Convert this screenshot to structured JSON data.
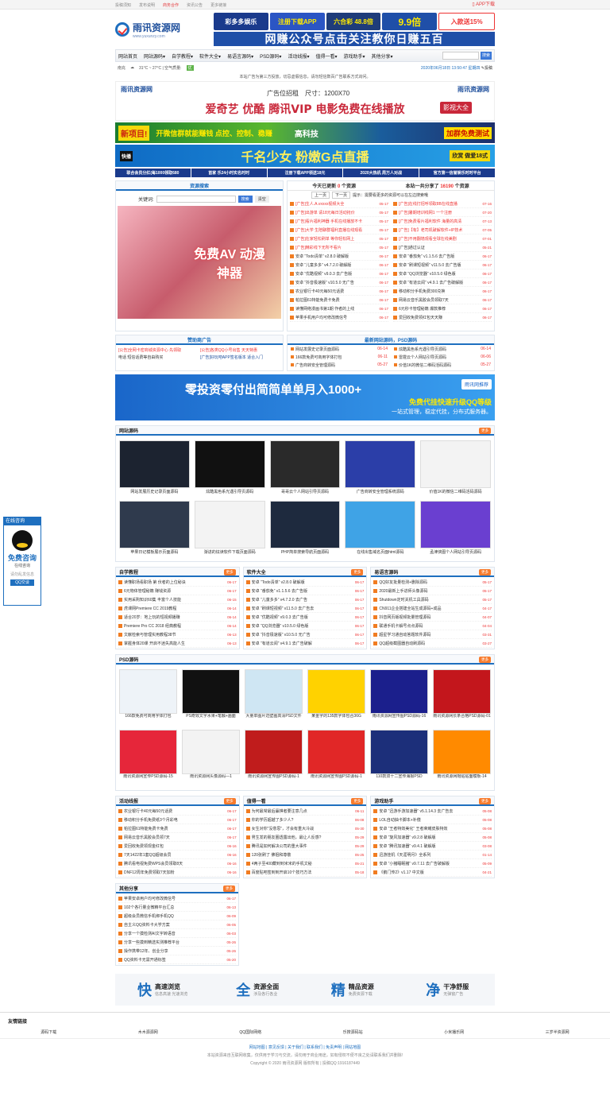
{
  "topbar": {
    "links": [
      "投稿须知",
      "发布说明",
      "商务合作",
      "资讯公告",
      "更多链接"
    ],
    "app": "APP下载"
  },
  "logo": {
    "name": "雨讯资源网",
    "url": "www.yuxunzy.com"
  },
  "header_ads": {
    "a": "彩多多娱乐",
    "b": "注册下载APP",
    "c": "六合彩 48.8倍",
    "d": "9.9倍",
    "e": "入款送15%",
    "big": "网赚公众号点击关注教你日赚五百"
  },
  "nav": {
    "items": [
      "网站首页",
      "网站源码▾",
      "自学教程▾",
      "软件大全▾",
      "易语言源码▾",
      "PSD源码▾",
      "活动线报▾",
      "值得一看▾",
      "游戏助手▾",
      "其他分享▾"
    ],
    "search_btn": "搜索"
  },
  "sub": {
    "city": "南充",
    "weather": "31°C ~ 27°C  | 空气质量:",
    "aqi": "优",
    "datetime": "2020年06月18日 13:50:47 星期四",
    "post": "投稿"
  },
  "notice": "本站广告为第三方投放，切忌虚假信息，请勿轻信数百广告联系方式询问。",
  "banner1": {
    "l1": "广告位招租",
    "size": "尺寸：1200X70",
    "l2": "爱奇艺 优酷 腾讯VIP 电影免费在线播放",
    "tag": "影视大全",
    "logo": "雨讯资源网"
  },
  "banner2": {
    "a": "新项目!",
    "b": "开微信群就能赚钱 点控、控制、稳赚",
    "c": "高科技",
    "d": "加群免费测试"
  },
  "banner3": {
    "kk": "快播",
    "main": "千名少女 粉嫩G点直播",
    "tag": "欣赏 做爱18式"
  },
  "banner4": [
    "联合会员分红(每1000领取680",
    "首家 乐24小时实名时时",
    "注册下载APP领送18元",
    "2020大热机 周万人对战",
    "官方第一信誉娱乐时时平台"
  ],
  "search_panel": {
    "title": "资源搜索",
    "label": "关键词:",
    "btn": "搜索",
    "btn2": "清空",
    "ad": "免费AV 动漫神器"
  },
  "stats": {
    "today_label": "今天已更新",
    "today": "0",
    "today_unit": "个资源",
    "total_label": "本站一共分享了",
    "total": "16190",
    "total_unit": "个资源",
    "prev": "上一页",
    "next": "下一页",
    "tip": "提示：需要看更多的资源可以在左边搜索哦"
  },
  "updates_left": [
    {
      "t": "[广告]生人.A.vxxxx视频大全",
      "d": "05-17",
      "red": true
    },
    {
      "t": "[广告]出游单 请18元每日活动抢价",
      "d": "05-17",
      "red": true
    },
    {
      "t": "[广告]看片福利神器 手机在线播放不卡",
      "d": "05-17",
      "red": true
    },
    {
      "t": "[广告]大学 生陪聊群福利直播在线观看",
      "d": "05-17",
      "red": true
    },
    {
      "t": "[广告]在家轻松刷单 等你轻松网上",
      "d": "05-17",
      "red": true
    },
    {
      "t": "[广告]精彩线下无所不看片",
      "d": "05-17",
      "red": true
    },
    {
      "t": "安卓 “Todo清单” v2.8.0 破解版",
      "d": "06-17",
      "red": false
    },
    {
      "t": "安卓 “儿童多多” v4.7.2.0 破解版",
      "d": "06-17",
      "red": false
    },
    {
      "t": "安卓 “优酷视频” v9.0.3 去广告版",
      "d": "06-17",
      "red": false
    },
    {
      "t": "安卓 “抖音极速版” v10.5.0 无广告",
      "d": "06-17",
      "red": false
    },
    {
      "t": "农业银行卡40元每50元话费",
      "d": "06-17",
      "red": false
    },
    {
      "t": "帕拉图61特能免费卡免费",
      "d": "06-17",
      "red": false
    },
    {
      "t": "读懂网络漫画书第1期 作者的上线",
      "d": "06-17",
      "red": false
    },
    {
      "t": "苹果手机用户均可修改微信号",
      "d": "06-17",
      "red": false
    }
  ],
  "updates_right": [
    {
      "t": "[广告]在线打招呼领取8B在线直播",
      "d": "07-16",
      "red": true
    },
    {
      "t": "[广告]暑期培训线网1 一个注册",
      "d": "07-20",
      "red": true
    },
    {
      "t": "[广告]免费看片福利软件 海量的高清",
      "d": "07-13",
      "red": true
    },
    {
      "t": "[广告]【有】老司机破解软件+IP技术",
      "d": "07-05",
      "red": true
    },
    {
      "t": "[广告]不用翻墙观看全球在线美剧",
      "d": "07-01",
      "red": true
    },
    {
      "t": "[广告]通过认证",
      "d": "05-21",
      "red": false
    },
    {
      "t": "安卓 “番茄免” v1.1.5.6 去广告版",
      "d": "06-17",
      "red": false
    },
    {
      "t": "安卓 “刷课短视频” v11.5.0 去广告版",
      "d": "06-17",
      "red": false
    },
    {
      "t": "安卓 “QQ浏览器” v10.5.0 绿色版",
      "d": "06-17",
      "red": false
    },
    {
      "t": "安卓 “有道云阅” v4.9.1 去广告破解版",
      "d": "06-17",
      "red": false
    },
    {
      "t": "移动积分手机免费300兑换",
      "d": "06-17",
      "red": false
    },
    {
      "t": "网易云音乐黑胶会员领取7天",
      "d": "06-17",
      "red": false
    },
    {
      "t": "6元秒卡管理秘籍 爆款推荐",
      "d": "06-17",
      "red": false
    },
    {
      "t": "爱回收免费领红包天天赚",
      "d": "06-17",
      "red": false
    }
  ],
  "sponsor": {
    "title": "赞助商广告",
    "items": [
      "[公告]全网卡密商城资源中心 先领取",
      "[公告]各类QQ小号出售 天天特惠",
      "电话 短信话费等自由购买",
      "[广告]好玩吧APP签名版本 适合入门"
    ]
  },
  "latest": {
    "title": "最新网站源码，PSD源码",
    "items": [
      {
        "t": "网站发展史记录页面源码",
        "d": "06-14"
      },
      {
        "t": "炫酷黑色系光遇引导页源码",
        "d": "06-14"
      },
      {
        "t": "166款免费可商用字体打包",
        "d": "06-11"
      },
      {
        "t": "雷霆云个人网站引导页源码",
        "d": "06-06"
      },
      {
        "t": "广告商转安全管理源码",
        "d": "05-27"
      },
      {
        "t": "价值1K的微信二维码活码源码",
        "d": "05-27"
      }
    ]
  },
  "wide_banner": {
    "main": "零投资零付出简简单单月入1000+",
    "sub": "一站式管理，稳定代挂，分布式服务器。",
    "right": "免费代挂快速升级QQ等级",
    "brand": "雨讯网推荐"
  },
  "site_code": {
    "title": "网站源码",
    "more": "更多",
    "items": [
      "网站发展历史记录页面源码",
      "炫酷黑色系光遇引导页源码",
      "哥哥云个人网站引导页源码",
      "广告商转安全管理系统源码",
      "价值1K的微信二维码活码源码",
      "苹果日记模板展示页面源码",
      "渐进的炫读软件下载页面源码",
      "PHP简单搜索导航页面源码",
      "在线出售域名页面html源码",
      "孟津侠图个人网站引导页源码"
    ]
  },
  "tutorial": {
    "title": "自学教程",
    "more": "更多",
    "items": [
      {
        "t": "读懂职场看职场 第 伏者的上位秘诀",
        "d": "06-17"
      },
      {
        "t": "6元物体管理秘籍 赚钱资源",
        "d": "06-17"
      },
      {
        "t": "实用采购知识60集 丰富个人技能",
        "d": "06-15"
      },
      {
        "t": "虎课网Premiere CC 2019教程",
        "d": "06-14"
      },
      {
        "t": "适合20岁：地上玩的短视频播赚",
        "d": "06-14"
      },
      {
        "t": "Premiere Pro CC 2018 经典教程",
        "d": "06-14"
      },
      {
        "t": "文献检索与管理实用教程38节",
        "d": "06-13"
      },
      {
        "t": "掌握身体20课 开启不迷失高能人生",
        "d": "06-13"
      }
    ]
  },
  "software": {
    "title": "软件大全",
    "more": "更多",
    "items": [
      {
        "t": "安卓 “Todo清单” v2.8.0 破解版",
        "d": "06-17"
      },
      {
        "t": "安卓 “番茄免” v1.1.5.6 去广告版",
        "d": "06-17"
      },
      {
        "t": "安卓 “儿童多多” v4.7.2.0 去广告",
        "d": "06-17"
      },
      {
        "t": "安卓 “刷课短视频” v11.5.0 去广告去",
        "d": "06-17"
      },
      {
        "t": "安卓 “优酷视频” v9.0.3 去广告版",
        "d": "06-17"
      },
      {
        "t": "安卓 “QQ浏览器” v10.5.0 绿色版",
        "d": "06-17"
      },
      {
        "t": "安卓 “抖音极速版” v10.5.0 无广告",
        "d": "06-17"
      },
      {
        "t": "安卓 “有道云阅” v4.9.1 去广告破解",
        "d": "06-17"
      }
    ]
  },
  "easylang": {
    "title": "易语言源码",
    "more": "更多",
    "items": [
      {
        "t": "QQ好友批量检测+删除源码",
        "d": "05-17"
      },
      {
        "t": "2020最新上手进师头像源码",
        "d": "05-17"
      },
      {
        "t": "Shutdown定时关机工具源码",
        "d": "05-17"
      },
      {
        "t": "CN911企业搭建全站生成源码+成品",
        "d": "04-17"
      },
      {
        "t": "抖音网页版视频批量管理源码",
        "d": "04-07"
      },
      {
        "t": "联通手机卡解号点点源码",
        "d": "04-04"
      },
      {
        "t": "超星学习通自动答题软件源码",
        "d": "03-31"
      },
      {
        "t": "QQ超级截图器自动刷源码",
        "d": "03-27"
      }
    ]
  },
  "psd": {
    "title": "PSD源码",
    "more": "更多",
    "items": [
      "166款免费可商用字体打包",
      "PS奇效文字水果+笔触+画面",
      "大量单图片迈壁画高清PSD文件",
      "某金字的135款字体包合36G",
      "雨讯资源网宣传图PSD源码-16",
      "雨讯资源网长条合格PSD源码-01",
      "雨讯资源网宣传PSD源码-15",
      "雨讯资源网头像源码—1",
      "雨讯资源网宣传图PSD源码-1",
      "雨讯资源网宣传图PSD源码-1",
      "110款双十二宣传海报PSD",
      "雨讯资源网帽贴贴面模板-14"
    ]
  },
  "activity": {
    "title": "活动线报",
    "more": "更多",
    "items": [
      {
        "t": "农业银行卡40元每50元话费",
        "d": "06-17"
      },
      {
        "t": "移动积分手机免费纸3个月彩电",
        "d": "06-17"
      },
      {
        "t": "帕拉图61特能免费卡免费",
        "d": "06-17"
      },
      {
        "t": "网易云音乐黑胶会员领7天",
        "d": "06-17"
      },
      {
        "t": "爱回收免费领现金红包",
        "d": "06-16"
      },
      {
        "t": "7天1422年1套QQ超级会员",
        "d": "06-16"
      },
      {
        "t": "腾讯看电视免费WPS会员领取8天",
        "d": "06-16"
      },
      {
        "t": "DNF12周年免费领取7天加粉",
        "d": "06-16"
      }
    ]
  },
  "worth": {
    "title": "值得一看",
    "more": "更多",
    "items": [
      {
        "t": "为何最常最后赢棋者要注意几点",
        "d": "06-11"
      },
      {
        "t": "你的学历超越了多少人?",
        "d": "06-08"
      },
      {
        "t": "女生对你“没意思”，才会有重大冷战",
        "d": "05-30"
      },
      {
        "t": "男生发的朋友圈透露出他，最让人反感?",
        "d": "05-29"
      },
      {
        "t": "腾讯是如何解决公司的重大事件",
        "d": "05-29"
      },
      {
        "t": "120张刷了 佛祖和尊敬",
        "d": "05-25"
      },
      {
        "t": "4两子至400藏到到米米的手机文秘",
        "d": "05-21"
      },
      {
        "t": "百度贴吧签到到开启10个技巧方法",
        "d": "05-18"
      }
    ]
  },
  "games": {
    "title": "游戏助手",
    "more": "更多",
    "items": [
      {
        "t": "安卓 “迅游手游加速器” v5.1.14.3 去广告去",
        "d": "05-08"
      },
      {
        "t": "LOL自动抽卡脚本+补偿",
        "d": "05-08"
      },
      {
        "t": "安卓 “王者特效美化” 王者荣耀皮肤特效",
        "d": "05-08"
      },
      {
        "t": "安卓 “旋风加速器” v9.2.8 破解版",
        "d": "05-08"
      },
      {
        "t": "安卓 “腾讯加速器” v9.4.1 破解版",
        "d": "03-08"
      },
      {
        "t": "迅游挂机《天涯明月》全系列",
        "d": "01-14"
      },
      {
        "t": "安卓 “小猪睡眠猪” v9.7.11 去广告破解版",
        "d": "05-09"
      },
      {
        "t": "《鹅门传2》v1.17 中文版",
        "d": "04-21"
      }
    ]
  },
  "other": {
    "title": "其他分享",
    "more": "更多",
    "items": [
      {
        "t": "苹果安卓用户均可修改微信号",
        "d": "06-17"
      },
      {
        "t": "102个各行量业微精平台汇总",
        "d": "06-13"
      },
      {
        "t": "超级会员微信手机绑手机QQ",
        "d": "06-09"
      },
      {
        "t": "自主义QQ资料卡大学方案",
        "d": "06-05"
      },
      {
        "t": "分享一个摸检测AI文字转语音",
        "d": "06-03"
      },
      {
        "t": "分享一些摸到精选实测推荐平台",
        "d": "05-26"
      },
      {
        "t": "操作携带12年、创业分享",
        "d": "05-26"
      },
      {
        "t": "QQ资料卡无需开通标签",
        "d": "05-20"
      }
    ]
  },
  "features": [
    {
      "big": "快",
      "t": "高速浏览",
      "s": "信息高速 光速浏览"
    },
    {
      "big": "全",
      "t": "资源全面",
      "s": "涉及各行各业"
    },
    {
      "big": "精",
      "t": "精品资源",
      "s": "免费资源下载"
    },
    {
      "big": "净",
      "t": "干净舒服",
      "s": "无弹窗广告"
    }
  ],
  "friends": {
    "title": "友情链接",
    "items": [
      "源码下载",
      "木木源源网",
      "QQ国际网络",
      "乐搜源码站",
      "小米播乐网",
      "三岁半资源网"
    ]
  },
  "footer": {
    "l1": "网站地图 | 意见反馈 | 关于我们 | 联系我们 | 免责声明 | 网站地图",
    "l2": "本站资源来自互联网收集，仅供用于学习与交流，请勿用于商业用途，如有侵权不便不良之处请联系我们并删除!",
    "l3": "Copyright © 2020 雨讯资源网 版权所有 | 投稿QQ:1916187449"
  },
  "float": {
    "hd": "在线咨询",
    "t": "免费咨询",
    "s": "在线咨询",
    "s2": "请勿乱发信息",
    "btn": "QQ交谈"
  }
}
